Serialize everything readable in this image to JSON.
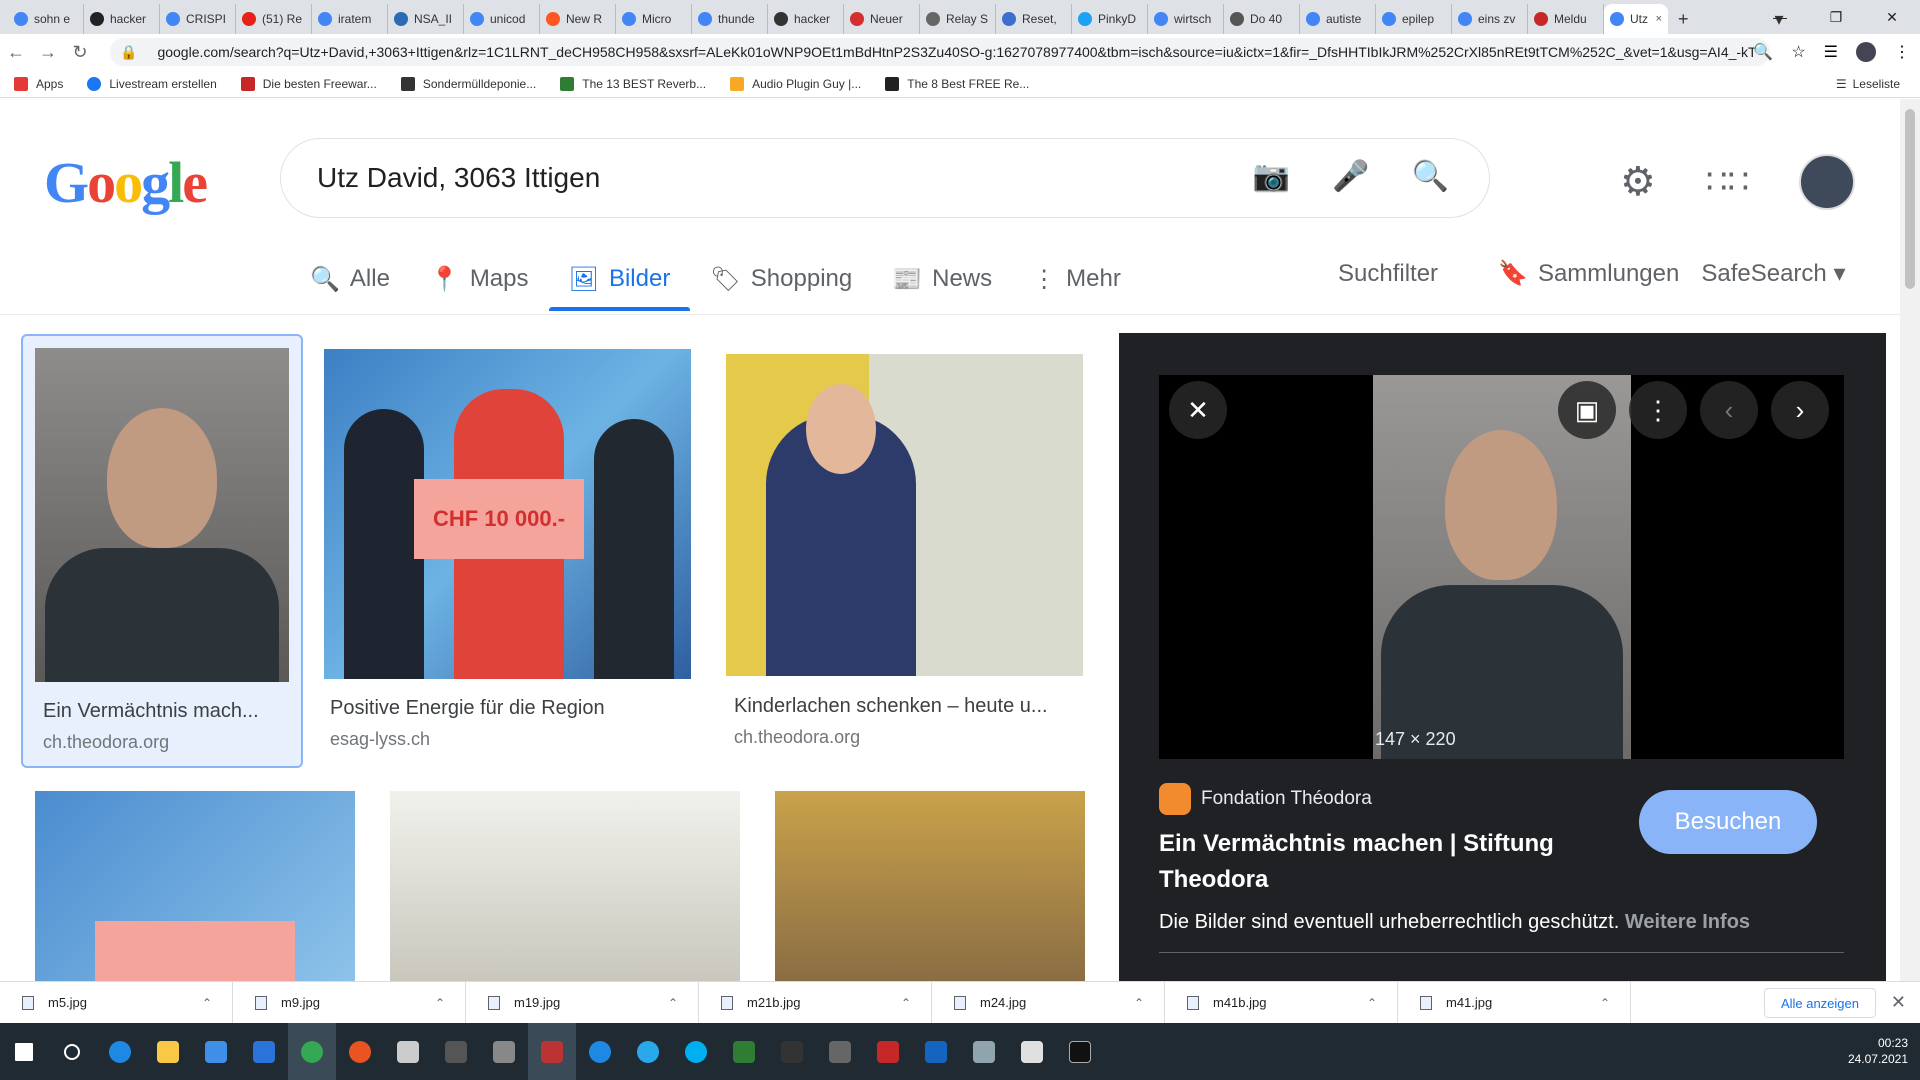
{
  "tabs": [
    {
      "label": "sohn e",
      "color": "#4285f4",
      "x": "×"
    },
    {
      "label": "hacker",
      "color": "#222",
      "x": "×"
    },
    {
      "label": "CRISPI",
      "color": "#4285f4",
      "x": "×"
    },
    {
      "label": "(51) Re",
      "color": "#e62117",
      "x": "×"
    },
    {
      "label": "iratem",
      "color": "#4285f4",
      "x": "×"
    },
    {
      "label": "NSA_II",
      "color": "#2a6cb3",
      "x": "×"
    },
    {
      "label": "unicod",
      "color": "#4285f4",
      "x": "×"
    },
    {
      "label": "New R",
      "color": "#ff5722",
      "x": "×"
    },
    {
      "label": "Micro",
      "color": "#4285f4",
      "x": "×"
    },
    {
      "label": "thunde",
      "color": "#4285f4",
      "x": "×"
    },
    {
      "label": "hacker",
      "color": "#333",
      "x": "×"
    },
    {
      "label": "Neuer",
      "color": "#d32f2f",
      "x": "×"
    },
    {
      "label": "Relay S",
      "color": "#666",
      "x": "×"
    },
    {
      "label": "Reset,",
      "color": "#3b6ecf",
      "x": "×"
    },
    {
      "label": "PinkyD",
      "color": "#1da1f2",
      "x": "×"
    },
    {
      "label": "wirtsch",
      "color": "#4285f4",
      "x": "×"
    },
    {
      "label": "Do 40",
      "color": "#555",
      "x": "×"
    },
    {
      "label": "autiste",
      "color": "#4285f4",
      "x": "×"
    },
    {
      "label": "epilep",
      "color": "#4285f4",
      "x": "×"
    },
    {
      "label": "eins zv",
      "color": "#4285f4",
      "x": "×"
    },
    {
      "label": "Meldu",
      "color": "#c62828",
      "x": "×"
    },
    {
      "label": "Utz",
      "color": "#4285f4",
      "x": "×"
    }
  ],
  "toolbar": {
    "url": "google.com/search?q=Utz+David,+3063+Ittigen&rlz=1C1LRNT_deCH958CH958&sxsrf=ALeKk01oWNP9OEt1mBdHtnP2S3Zu40SO-g:1627078977400&tbm=isch&source=iu&ictx=1&fir=_DfsHHTIbIkJRM%252CrXl85nREt9tTCM%252C_&vet=1&usg=AI4_-kTD..."
  },
  "bookmarks": [
    {
      "label": "Apps",
      "color": "#e53935"
    },
    {
      "label": "Livestream erstellen",
      "color": "#1877f2"
    },
    {
      "label": "Die besten Freewar...",
      "color": "#c62828"
    },
    {
      "label": "Sondermülldeponie...",
      "color": "#333"
    },
    {
      "label": "The 13 BEST Reverb...",
      "color": "#2e7d32"
    },
    {
      "label": "Audio Plugin Guy |...",
      "color": "#f9a825"
    },
    {
      "label": "The 8 Best FREE Re...",
      "color": "#212121"
    }
  ],
  "bookmarks_right": "Leseliste",
  "search": {
    "logo": "Google",
    "query": "Utz David, 3063 Ittigen"
  },
  "nav": {
    "all": "Alle",
    "maps": "Maps",
    "images": "Bilder",
    "shopping": "Shopping",
    "news": "News",
    "more": "Mehr",
    "filter": "Suchfilter",
    "collections": "Sammlungen",
    "safesearch": "SafeSearch"
  },
  "results": [
    {
      "title": "Ein Vermächtnis mach...",
      "source": "ch.theodora.org"
    },
    {
      "title": "Positive Energie für die Region",
      "source": "esag-lyss.ch"
    },
    {
      "title": "Kinderlachen schenken – heute u...",
      "source": "ch.theodora.org"
    }
  ],
  "check_text": "CHF 10 000.-",
  "preview": {
    "size": "147 × 220",
    "source": "Fondation Théodora",
    "title": "Ein Vermächtnis machen | Stiftung Theodora",
    "visit": "Besuchen",
    "copyright": "Die Bilder sind eventuell urheberrechtlich geschützt.",
    "more_info": "Weitere Infos"
  },
  "downloads": [
    "m5.jpg",
    "m9.jpg",
    "m19.jpg",
    "m21b.jpg",
    "m24.jpg",
    "m41b.jpg",
    "m41.jpg"
  ],
  "downloads_all": "Alle anzeigen",
  "taskbar": {
    "time": "00:23",
    "date": "24.07.2021"
  }
}
